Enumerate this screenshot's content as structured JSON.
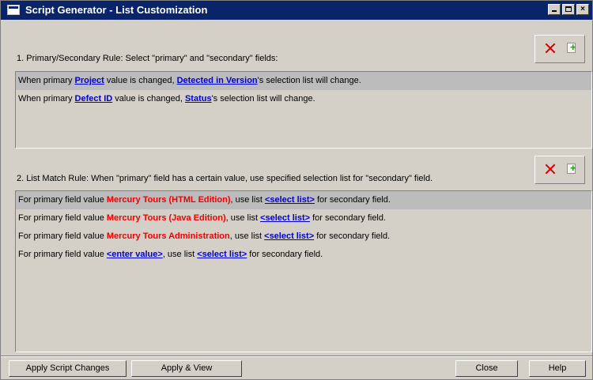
{
  "window": {
    "title": "Script Generator - List Customization"
  },
  "rule1": {
    "label": "1. Primary/Secondary Rule: Select \"primary\" and \"secondary\" fields:",
    "rows": [
      {
        "p1": "When primary ",
        "primary": "Project",
        "p2": " value is changed, ",
        "secondary": "Detected in Version",
        "p3": "'s selection list will change."
      },
      {
        "p1": "When primary ",
        "primary": "Defect ID",
        "p2": " value is changed, ",
        "secondary": "Status",
        "p3": "'s selection list will change."
      }
    ]
  },
  "rule2": {
    "label": "2. List Match Rule:  When \"primary\" field has a certain value, use specified selection list for \"secondary\" field.",
    "rows": [
      {
        "p1": "For primary field value ",
        "value": "Mercury Tours (HTML Edition)",
        "p2": ", use list ",
        "list": "<select list>",
        "p3": " for secondary field."
      },
      {
        "p1": "For primary field value ",
        "value": "Mercury Tours (Java Edition)",
        "p2": ", use list ",
        "list": "<select list>",
        "p3": " for secondary field."
      },
      {
        "p1": "For primary field value ",
        "value": "Mercury Tours Administration",
        "p2": ", use list ",
        "list": "<select list>",
        "p3": " for secondary field."
      },
      {
        "p1": "For primary field value ",
        "value": "<enter value>",
        "p2": ", use list ",
        "list": "<select list>",
        "p3": " for secondary field."
      }
    ]
  },
  "buttons": {
    "apply_script_changes": "Apply Script Changes",
    "apply_view": "Apply & View",
    "close": "Close",
    "help": "Help"
  },
  "icons": {
    "delete": "delete-x-icon",
    "add": "add-item-icon"
  },
  "colors": {
    "titlebar": "#0a246a",
    "link": "#0000d0",
    "value_highlight": "#f00000",
    "dialog_bg": "#d4d0c8"
  }
}
